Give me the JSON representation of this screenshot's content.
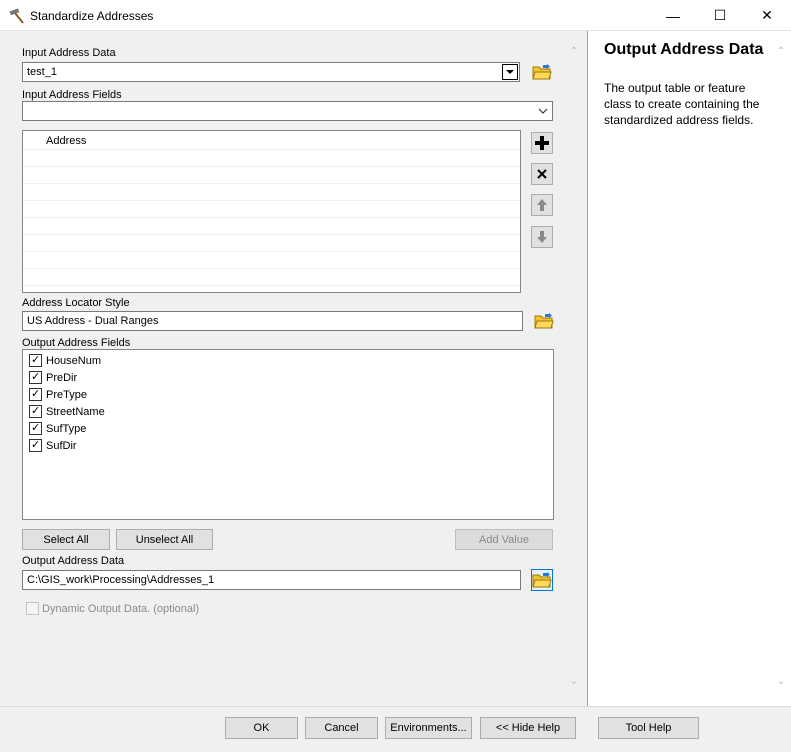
{
  "window": {
    "title": "Standardize Addresses",
    "icon": "hammer-icon",
    "controls": {
      "minimize": "—",
      "maximize": "☐",
      "close": "✕"
    }
  },
  "form": {
    "input_address_data": {
      "label": "Input Address Data",
      "value": "test_1"
    },
    "input_address_fields": {
      "label": "Input Address Fields",
      "value": "",
      "grid_header": "Address",
      "rows": [
        "",
        "",
        "",
        "",
        "",
        "",
        "",
        ""
      ]
    },
    "address_locator_style": {
      "label": "Address Locator Style",
      "value": "US Address - Dual Ranges"
    },
    "output_address_fields": {
      "label": "Output Address Fields",
      "items": [
        {
          "label": "HouseNum",
          "checked": true
        },
        {
          "label": "PreDir",
          "checked": true
        },
        {
          "label": "PreType",
          "checked": true
        },
        {
          "label": "StreetName",
          "checked": true
        },
        {
          "label": "SufType",
          "checked": true
        },
        {
          "label": "SufDir",
          "checked": true
        }
      ],
      "select_all": "Select All",
      "unselect_all": "Unselect All",
      "add_value": "Add Value"
    },
    "output_address_data": {
      "label": "Output Address Data",
      "value": "C:\\GIS_work\\Processing\\Addresses_1"
    },
    "dynamic_output": {
      "label": "Dynamic Output Data. (optional)",
      "checked": false
    }
  },
  "help": {
    "title": "Output Address Data",
    "body": "The output table or feature class to create containing the standardized address fields."
  },
  "buttons": {
    "ok": "OK",
    "cancel": "Cancel",
    "environments": "Environments...",
    "hide_help": "<< Hide Help",
    "tool_help": "Tool Help"
  },
  "colors": {
    "folder": "#e8b400",
    "focus": "#0078d7"
  }
}
